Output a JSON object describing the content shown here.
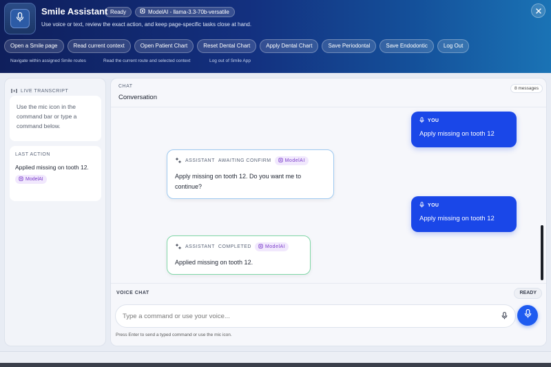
{
  "header": {
    "title": "Smile Assistant",
    "status": "Ready",
    "model": "ModelAI - llama-3.3-70b-versatile",
    "subtitle": "Use voice or text, review the exact action, and keep page-specific tasks close at hand.",
    "actions": [
      "Open a Smile page",
      "Read current context",
      "Open Patient Chart",
      "Reset Dental Chart",
      "Apply Dental Chart",
      "Save Periodontal",
      "Save Endodontic",
      "Log Out"
    ],
    "hints": [
      "Navigate within assigned Smile routes",
      "Read the current route and selected context",
      "Log out of Smile App"
    ]
  },
  "left": {
    "transcript_label": "LIVE TRANSCRIPT",
    "transcript_text": "Use the mic icon in the command bar or type a command below.",
    "last_action_label": "LAST ACTION",
    "last_action_value": "Applied missing on tooth 12.",
    "last_action_model": "ModelAI"
  },
  "chat": {
    "label": "CHAT",
    "title": "Conversation",
    "count": "8 messages",
    "messages": [
      {
        "role": "user",
        "who": "YOU",
        "text": "Apply missing on tooth 12"
      },
      {
        "role": "assistant",
        "who": "ASSISTANT",
        "status": "AWAITING CONFIRM",
        "model": "ModelAI",
        "text": "Apply missing on tooth 12. Do you want me to continue?"
      },
      {
        "role": "user",
        "who": "YOU",
        "text": "Apply missing on tooth 12"
      },
      {
        "role": "assistant",
        "who": "ASSISTANT",
        "status": "COMPLETED",
        "model": "ModelAI",
        "text": "Applied missing on tooth 12."
      }
    ]
  },
  "voice": {
    "label": "VOICE CHAT",
    "status": "READY",
    "placeholder": "Type a command or use your voice...",
    "hint": "Press Enter to send a typed command or use the mic icon."
  },
  "colors": {
    "accent": "#1a47e8",
    "awaiting_border": "#9cc8f0",
    "completed_border": "#7fd6a6",
    "model_tag": "#7a3cc9"
  }
}
